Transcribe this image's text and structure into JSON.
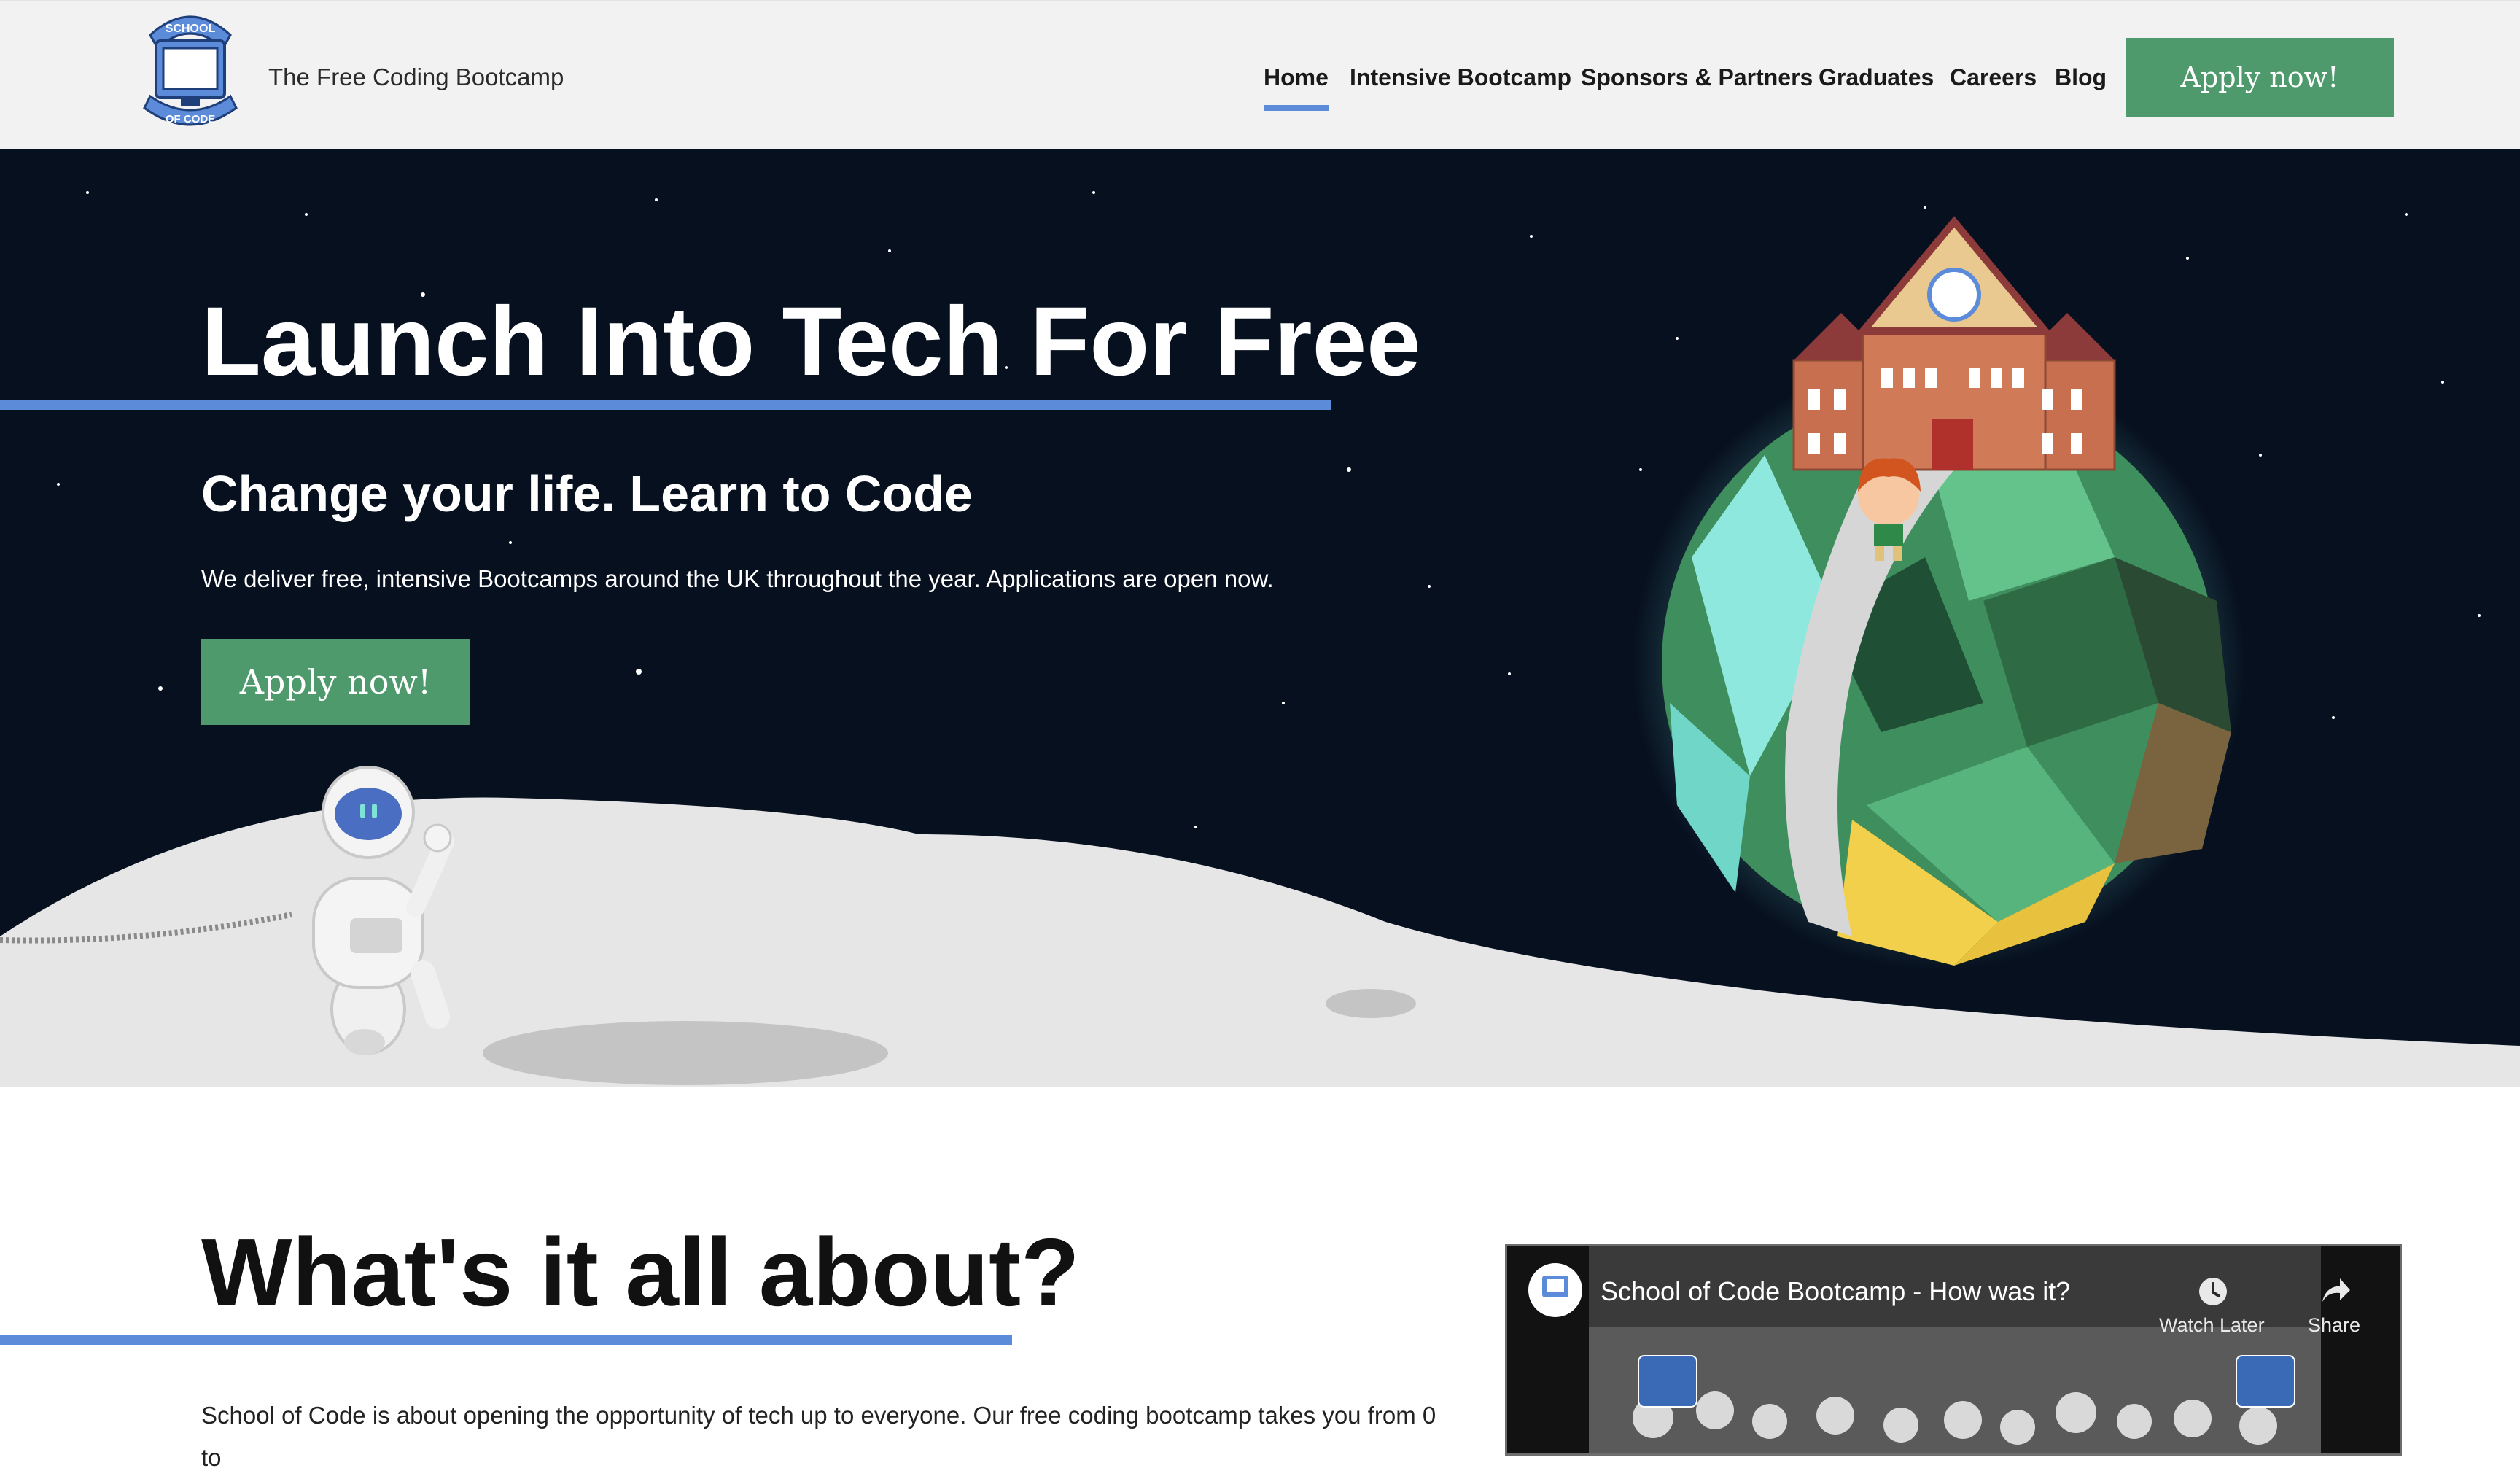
{
  "header": {
    "brand_tagline": "The Free Coding Bootcamp",
    "nav": [
      "Home",
      "Intensive Bootcamp",
      "Sponsors & Partners",
      "Graduates",
      "Careers",
      "Blog"
    ],
    "active_nav": "Home",
    "apply_label": "Apply now!",
    "logo_text": [
      "SCHOOL",
      "OF CODE"
    ]
  },
  "hero": {
    "title": "Launch Into Tech For Free",
    "subtitle": "Change your life. Learn to Code",
    "text": "We deliver free, intensive Bootcamps around the UK throughout the year. Applications are open now.",
    "apply_label": "Apply now!"
  },
  "about": {
    "title": "What's it all about?",
    "text": "School of Code is about opening the opportunity of tech up to everyone. Our free coding bootcamp takes you from 0 to"
  },
  "video": {
    "title": "School of Code Bootcamp - How was it?",
    "watch_later": "Watch Later",
    "share": "Share"
  },
  "colors": {
    "accent_blue": "#5b8bd9",
    "button_green": "#4f9a6d",
    "hero_bg": "#07101f",
    "header_bg": "#f2f2f2"
  }
}
